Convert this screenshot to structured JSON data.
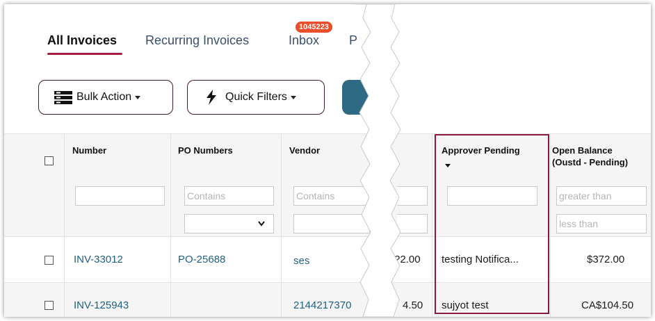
{
  "tabs": [
    {
      "label": "All Invoices",
      "active": true
    },
    {
      "label": "Recurring Invoices",
      "active": false
    },
    {
      "label": "Inbox",
      "active": false,
      "badge": "1045223"
    },
    {
      "label": "P",
      "active": false
    }
  ],
  "toolbar": {
    "bulk_action_label": "Bulk Action",
    "quick_filters_label": "Quick Filters"
  },
  "table": {
    "columns": {
      "number": "Number",
      "po_numbers": "PO Numbers",
      "vendor": "Vendor",
      "approver_pending": "Approver Pending",
      "open_balance_line1": "Open Balance",
      "open_balance_line2": "(Oustd - Pending)"
    },
    "filters": {
      "po_placeholder": "Contains",
      "vendor_placeholder": "Contains",
      "balance_min_placeholder": "greater than",
      "balance_max_placeholder": "less than"
    },
    "rows": [
      {
        "number": "INV-33012",
        "po": "PO-25688",
        "vendor": "ses",
        "partial_amount": "?2.00",
        "approver": "testing Notifica...",
        "balance": "$372.00"
      },
      {
        "number": "INV-125943",
        "po": "",
        "vendor": "2144217370",
        "partial_amount": "4.50",
        "approver": "sujyot test",
        "balance": "CA$104.50"
      }
    ]
  },
  "colors": {
    "accent": "#a31e3d",
    "link": "#1f6082",
    "badge": "#ea4e2b",
    "highlight_border": "#8b1a3c"
  }
}
